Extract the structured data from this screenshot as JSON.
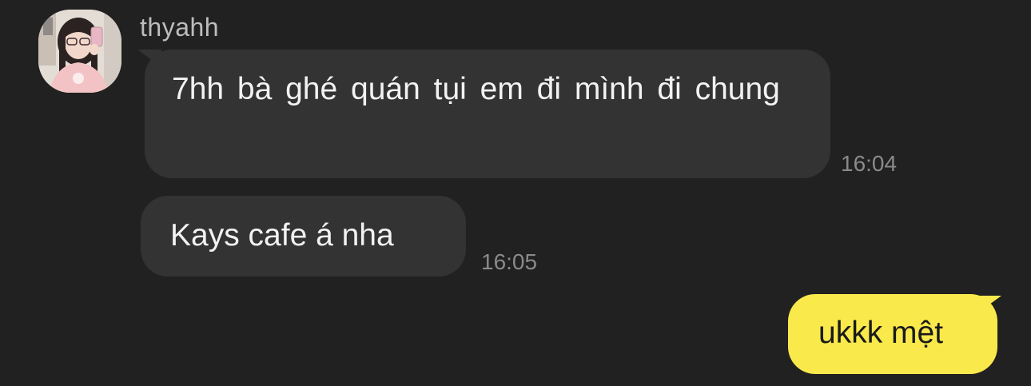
{
  "contact": {
    "name": "thyahh",
    "avatar_icon": "profile-photo-icon"
  },
  "messages": [
    {
      "direction": "incoming",
      "text": "7hh bà ghé quán tụi em đi mình đi chung",
      "time": "16:04"
    },
    {
      "direction": "incoming",
      "text": "Kays cafe á nha",
      "time": "16:05"
    },
    {
      "direction": "outgoing",
      "text": "ukkk mệt"
    }
  ],
  "colors": {
    "background": "#212121",
    "incoming_bubble": "#333333",
    "outgoing_bubble": "#fae94b",
    "timestamp": "#8a8a8a",
    "sender_name": "#bdbdbd"
  }
}
